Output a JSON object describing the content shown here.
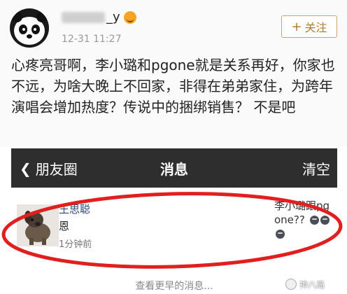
{
  "post": {
    "username_suffix": "_y",
    "timestamp": "12-31 11:27",
    "follow_label": "关注",
    "content": "心疼亮哥啊，李小璐和pgone就是关系再好，你家也不远，为啥大晚上不回家，非得在弟弟家住，为跨年演唱会增加热度？传说中的捆绑销售？ 不是吧"
  },
  "messages": {
    "back_label": "朋友圈",
    "title": "消息",
    "clear_label": "清空",
    "item": {
      "sender": "王思聪",
      "text": "恩",
      "time": "1分钟前",
      "preview": "李小璐跟pgone??"
    },
    "more_label": "查看更早的消息..."
  },
  "watermark": {
    "text": "神八局"
  },
  "colors": {
    "annotation_circle": "#e11f1f",
    "follow_accent": "#b07c2c",
    "navbar_bg": "#2e2e2e"
  }
}
